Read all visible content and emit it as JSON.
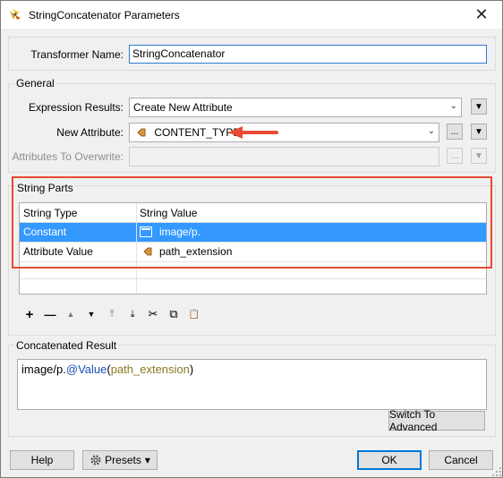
{
  "window": {
    "title": "StringConcatenator Parameters",
    "close_glyph": "✕"
  },
  "transformer": {
    "label": "Transformer Name:",
    "value": "StringConcatenator"
  },
  "general": {
    "title": "General",
    "expression_label": "Expression Results:",
    "expression_value": "Create New Attribute",
    "new_attr_label": "New Attribute:",
    "new_attr_value": "CONTENT_TYPE",
    "overwrite_label": "Attributes To Overwrite:",
    "ellipsis": "...",
    "chevron": "▼"
  },
  "string_parts": {
    "title": "String Parts",
    "columns": [
      "String Type",
      "String Value"
    ],
    "rows": [
      {
        "type": "Constant",
        "value": "image/p.",
        "icon": "constant-icon"
      },
      {
        "type": "Attribute Value",
        "value": "path_extension",
        "icon": "attribute-tag-icon"
      }
    ],
    "toolbar": {
      "add": "+",
      "remove": "—",
      "move_up": "▲",
      "move_down": "▼",
      "move_top": "⤒",
      "move_bottom": "⤓",
      "cut": "✂",
      "copy": "⧉",
      "paste": "📋"
    }
  },
  "result": {
    "title": "Concatenated Result",
    "constant_part": "image/p.",
    "func_part": "@Value",
    "open_paren": "(",
    "attr_part": "path_extension",
    "close_paren": ")",
    "advanced_button": "Switch To Advanced"
  },
  "footer": {
    "help": "Help",
    "presets": "Presets",
    "presets_chevron": "▾",
    "ok": "OK",
    "cancel": "Cancel"
  },
  "colors": {
    "highlight": "#e84a34",
    "selection": "#3399ff",
    "func": "#1a4fb4",
    "attr": "#8a7a1f"
  }
}
